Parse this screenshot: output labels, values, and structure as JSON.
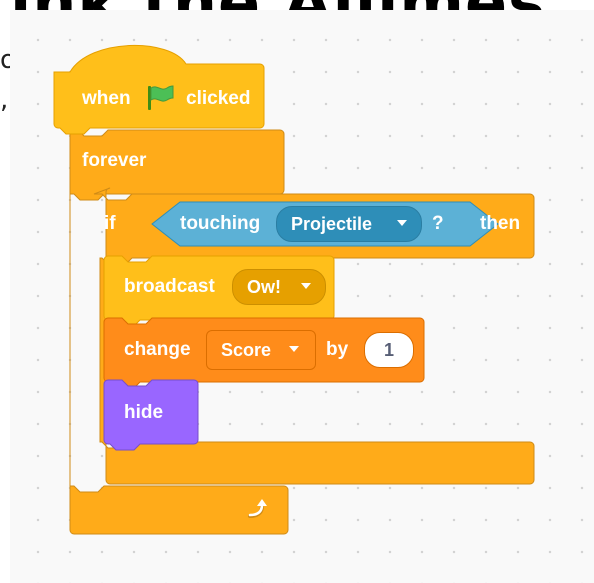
{
  "heading": {
    "text": "ink the Aliimes"
  },
  "side_fragment": {
    "line1": "o",
    "line2": ","
  },
  "script": {
    "hat": {
      "when": "when",
      "clicked": "clicked",
      "flag_icon": "green-flag-icon"
    },
    "forever": {
      "label": "forever",
      "loop_icon": "loop-arrow-icon"
    },
    "if_block": {
      "if": "if",
      "then": "then"
    },
    "touching": {
      "label": "touching",
      "target": "Projectile",
      "question": "?"
    },
    "broadcast": {
      "label": "broadcast",
      "message": "Ow!"
    },
    "change": {
      "label": "change",
      "variable": "Score",
      "by": "by",
      "amount": "1"
    },
    "hide": {
      "label": "hide"
    }
  },
  "colors": {
    "events": "#ffbf1a",
    "events_dark": "#e6a000",
    "control": "#ffab19",
    "control_dark": "#cf8b17",
    "sensing": "#5cb1d6",
    "sensing_dark": "#2e8eb8",
    "variables": "#ff8c1a",
    "variables_dark": "#db6e00",
    "looks": "#9966ff",
    "looks_dark": "#774dcb"
  }
}
